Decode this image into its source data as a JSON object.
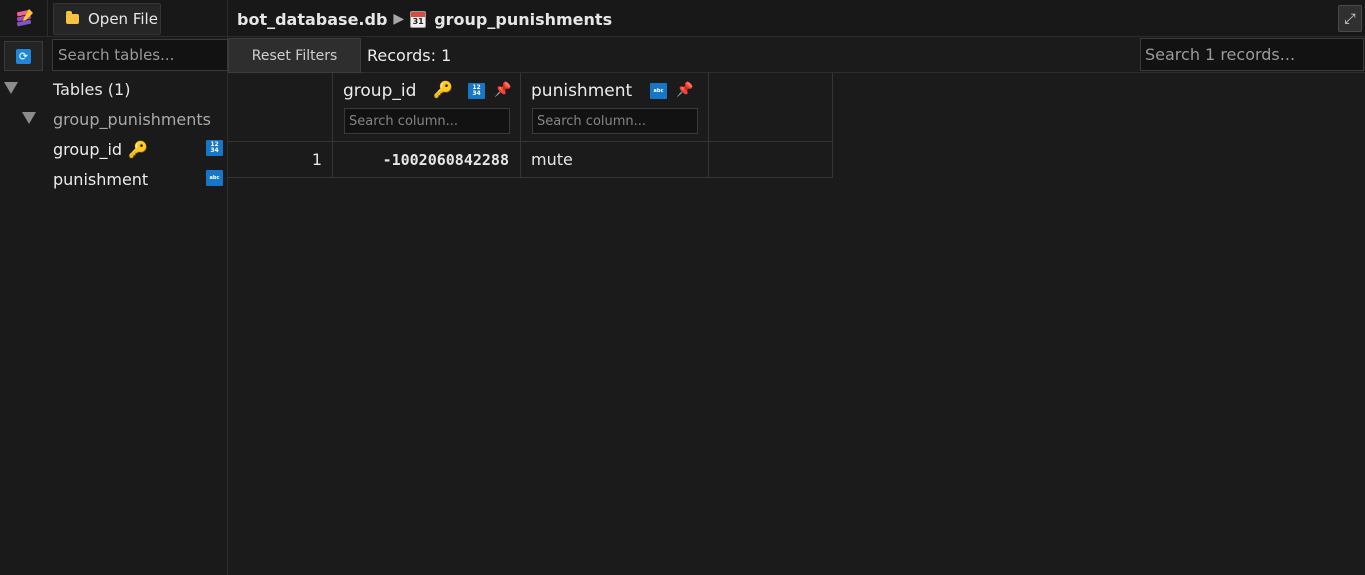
{
  "toolbar": {
    "open_file_label": "Open File",
    "database_name": "bot_database.db",
    "breadcrumb_separator": "▶",
    "table_icon_day": "31",
    "current_table": "group_punishments",
    "expand_glyph": "⤢"
  },
  "sidebar": {
    "search_placeholder": "Search tables...",
    "tables_heading": "Tables (1)",
    "table_name": "group_punishments",
    "columns": [
      {
        "name": "group_id",
        "primary_key": true,
        "type_badge": "12\n34"
      },
      {
        "name": "punishment",
        "primary_key": false,
        "type_badge": "abc"
      }
    ]
  },
  "grid_toolbar": {
    "reset_filters_label": "Reset Filters",
    "records_label": "Records: 1",
    "search_placeholder": "Search 1 records..."
  },
  "grid": {
    "columns": [
      {
        "name": "group_id",
        "filter_placeholder": "Search column...",
        "type_badge": "12\n34",
        "primary_key": true
      },
      {
        "name": "punishment",
        "filter_placeholder": "Search column...",
        "type_badge": "abc",
        "primary_key": false
      }
    ],
    "rows": [
      {
        "row_number": "1",
        "group_id": "-1002060842288",
        "punishment": "mute"
      }
    ]
  },
  "colors": {
    "background": "#1b1b1b",
    "accent_blue": "#1677c9",
    "key_gold": "#f0a830",
    "pin_red": "#e0412f"
  }
}
